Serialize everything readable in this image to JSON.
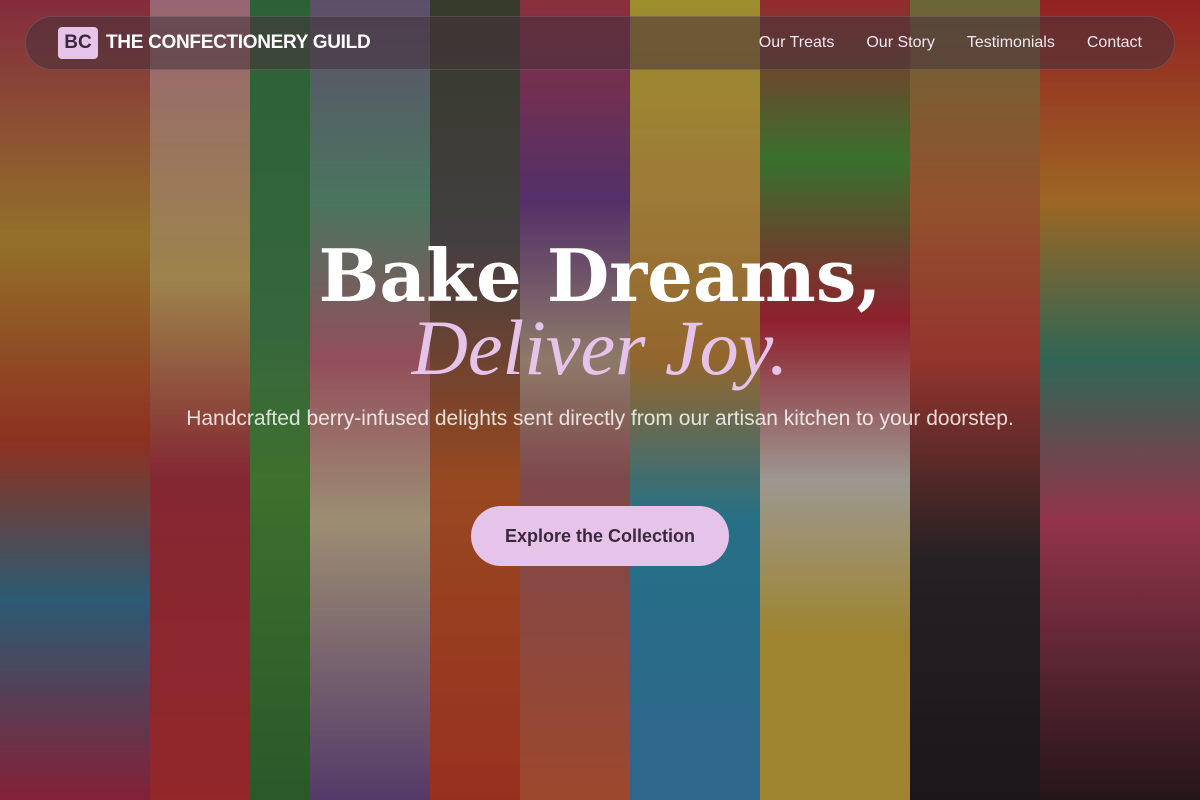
{
  "brand": {
    "badge": "BC",
    "name": "THE CONFECTIONERY GUILD"
  },
  "nav": {
    "links": [
      "Our Treats",
      "Our Story",
      "Testimonials",
      "Contact"
    ]
  },
  "hero": {
    "headline": "Bake Dreams,",
    "accent": "Deliver Joy.",
    "subtitle": "Handcrafted berry-infused delights sent directly from our artisan kitchen to your doorstep.",
    "cta_label": "Explore the Collection"
  },
  "colors": {
    "accent": "#e6c3e8",
    "accent_text": "#3b2a3e"
  }
}
